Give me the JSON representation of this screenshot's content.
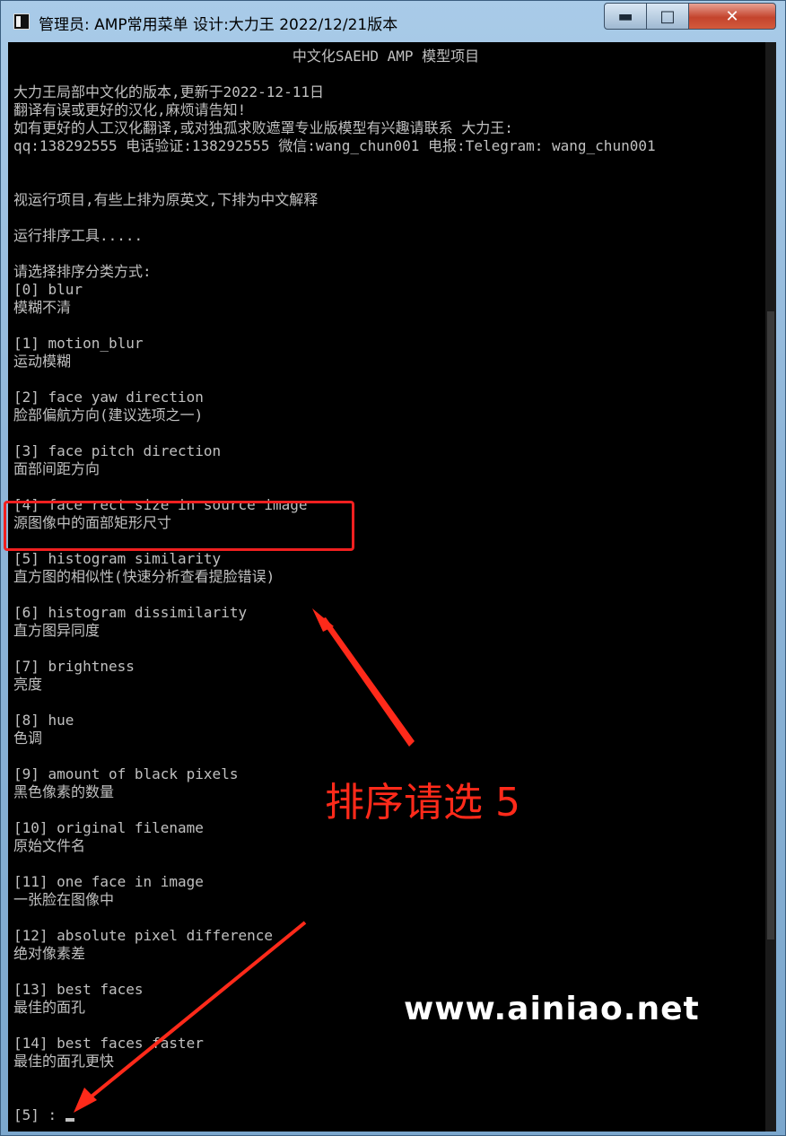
{
  "window": {
    "title": "管理员:  AMP常用菜单 设计:大力王 2022/12/21版本",
    "controls": {
      "minimize": "▬",
      "maximize": "□",
      "close": "✕"
    }
  },
  "console": {
    "lines": [
      "中文化SAEHD AMP 模型项目",
      "",
      "大力王局部中文化的版本,更新于2022-12-11日",
      "翻译有误或更好的汉化,麻烦请告知!",
      "如有更好的人工汉化翻译,或对独孤求败遮罩专业版模型有兴趣请联系 大力王:",
      "qq:138292555 电话验证:138292555 微信:wang_chun001 电报:Telegram: wang_chun001",
      "",
      "",
      "视运行项目,有些上排为原英文,下排为中文解释",
      "",
      "运行排序工具.....",
      "",
      "请选择排序分类方式:",
      "[0] blur",
      "模糊不清",
      "",
      "[1] motion_blur",
      "运动模糊",
      "",
      "[2] face yaw direction",
      "脸部偏航方向(建议选项之一)",
      "",
      "[3] face pitch direction",
      "面部间距方向",
      "",
      "[4] face rect size in source image",
      "源图像中的面部矩形尺寸",
      "",
      "[5] histogram similarity",
      "直方图的相似性(快速分析查看提脸错误)",
      "",
      "[6] histogram dissimilarity",
      "直方图异同度",
      "",
      "[7] brightness",
      "亮度",
      "",
      "[8] hue",
      "色调",
      "",
      "[9] amount of black pixels",
      "黑色像素的数量",
      "",
      "[10] original filename",
      "原始文件名",
      "",
      "[11] one face in image",
      "一张脸在图像中",
      "",
      "[12] absolute pixel difference",
      "绝对像素差",
      "",
      "[13] best faces",
      "最佳的面孔",
      "",
      "[14] best faces faster",
      "最佳的面孔更快",
      "",
      "",
      "[5] : "
    ]
  },
  "annotation": {
    "text": "排序请选 5",
    "color": "#ff2a1a"
  },
  "watermark": {
    "text": "www.ainiao.net"
  }
}
